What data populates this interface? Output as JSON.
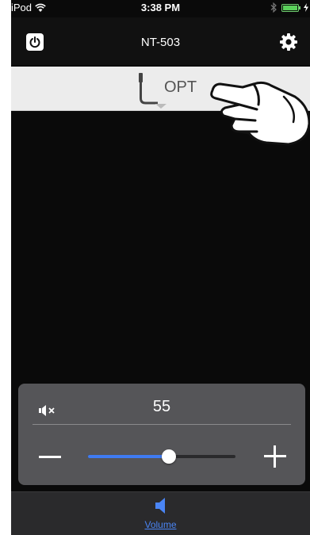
{
  "status_bar": {
    "carrier": "iPod",
    "time": "3:38 PM"
  },
  "nav": {
    "title": "NT-503"
  },
  "input_selector": {
    "current_input": "OPT"
  },
  "volume": {
    "value": "55",
    "level_fraction": 0.55
  },
  "tab_bar": {
    "items": [
      {
        "label": "Volume",
        "icon": "speaker-icon",
        "active": true
      }
    ]
  },
  "colors": {
    "accent": "#3f7bf2",
    "panel": "#555558",
    "background": "#0a0a0a",
    "battery": "#5ad05a"
  }
}
